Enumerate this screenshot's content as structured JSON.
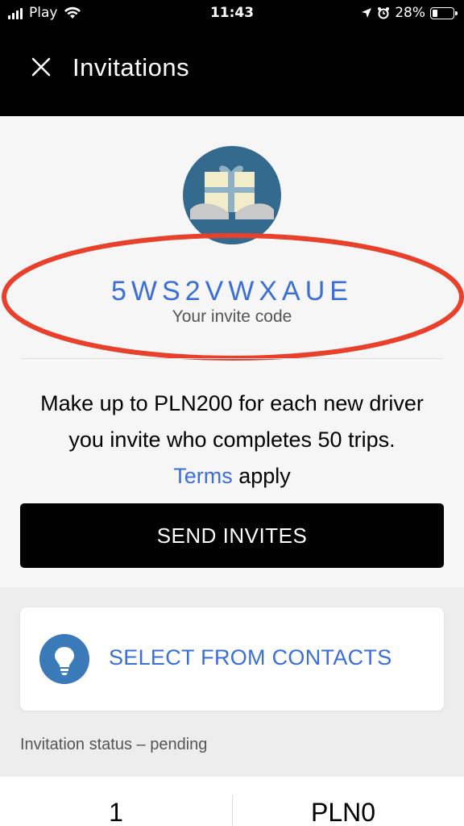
{
  "status_bar": {
    "carrier": "Play",
    "time": "11:43",
    "battery": "28%",
    "battery_level": 0.28
  },
  "header": {
    "title": "Invitations"
  },
  "invite": {
    "code": "5WS2VWXAUE",
    "code_label": "Your invite code",
    "description_line1": "Make up to PLN200 for each new driver",
    "description_line2": "you invite who completes 50 trips.",
    "terms_link": "Terms",
    "terms_suffix": " apply",
    "send_button": "SEND INVITES"
  },
  "contacts": {
    "label": "SELECT FROM CONTACTS"
  },
  "invitation_status": {
    "label": "Invitation status – pending",
    "count": "1",
    "earnings": "PLN0"
  },
  "colors": {
    "accent_blue": "#3a6fd8",
    "highlight_red": "#e8402b",
    "icon_blue": "#3b7ab8"
  }
}
